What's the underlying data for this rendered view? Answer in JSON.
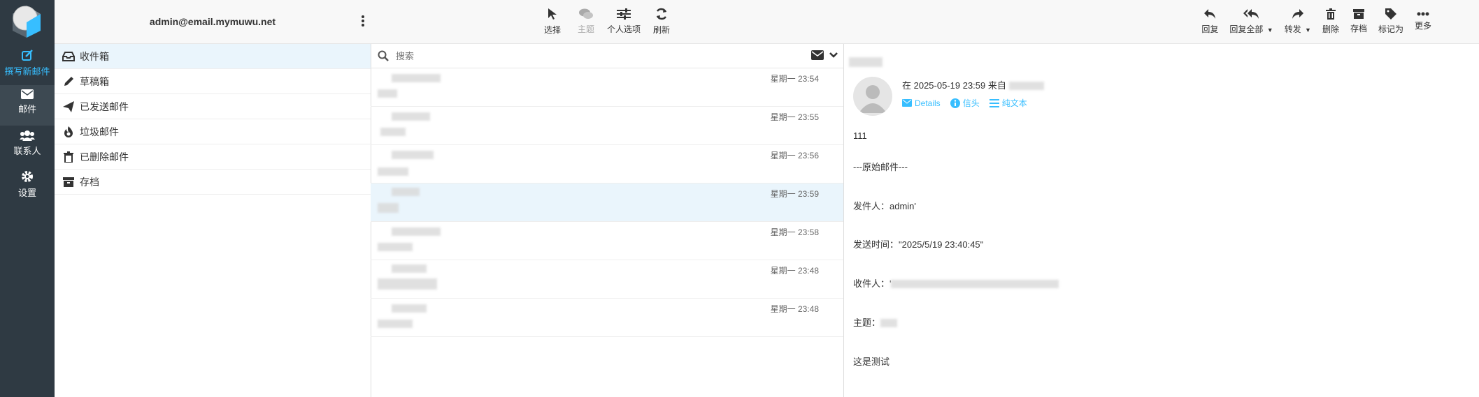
{
  "rail": {
    "compose": "撰写新邮件",
    "mail": "邮件",
    "contacts": "联系人",
    "settings": "设置"
  },
  "account": "admin@email.mymuwu.net",
  "folders": [
    "收件箱",
    "草稿箱",
    "已发送邮件",
    "垃圾邮件",
    "已删除邮件",
    "存档"
  ],
  "list_toolbar": {
    "select": "选择",
    "thread": "主题",
    "options": "个人选项",
    "refresh": "刷新"
  },
  "search": {
    "placeholder": "搜索"
  },
  "messages": [
    {
      "date": "星期一 23:54"
    },
    {
      "date": "星期一 23:55"
    },
    {
      "date": "星期一 23:56"
    },
    {
      "date": "星期一 23:59"
    },
    {
      "date": "星期一 23:58"
    },
    {
      "date": "星期一 23:48"
    },
    {
      "date": "星期一 23:48"
    }
  ],
  "read_toolbar": {
    "reply": "回复",
    "reply_all": "回复全部",
    "forward": "转发",
    "delete": "删除",
    "archive": "存档",
    "mark": "标记为",
    "more": "更多"
  },
  "message": {
    "header_line": "在 2025-05-19 23:59 来自",
    "details": "Details",
    "headers": "信头",
    "plain": "纯文本",
    "body": {
      "line1": "111",
      "line2": "---原始邮件---",
      "sender": "发件人：admin'",
      "sent_time": "发送时间：\"2025/5/19 23:40:45\"",
      "recipient": "收件人：'",
      "subject": "主题：",
      "text": "这是测试"
    }
  },
  "colors": {
    "rail": "#2f3a43",
    "accent": "#37beff",
    "selected": "#eaf5fc"
  }
}
